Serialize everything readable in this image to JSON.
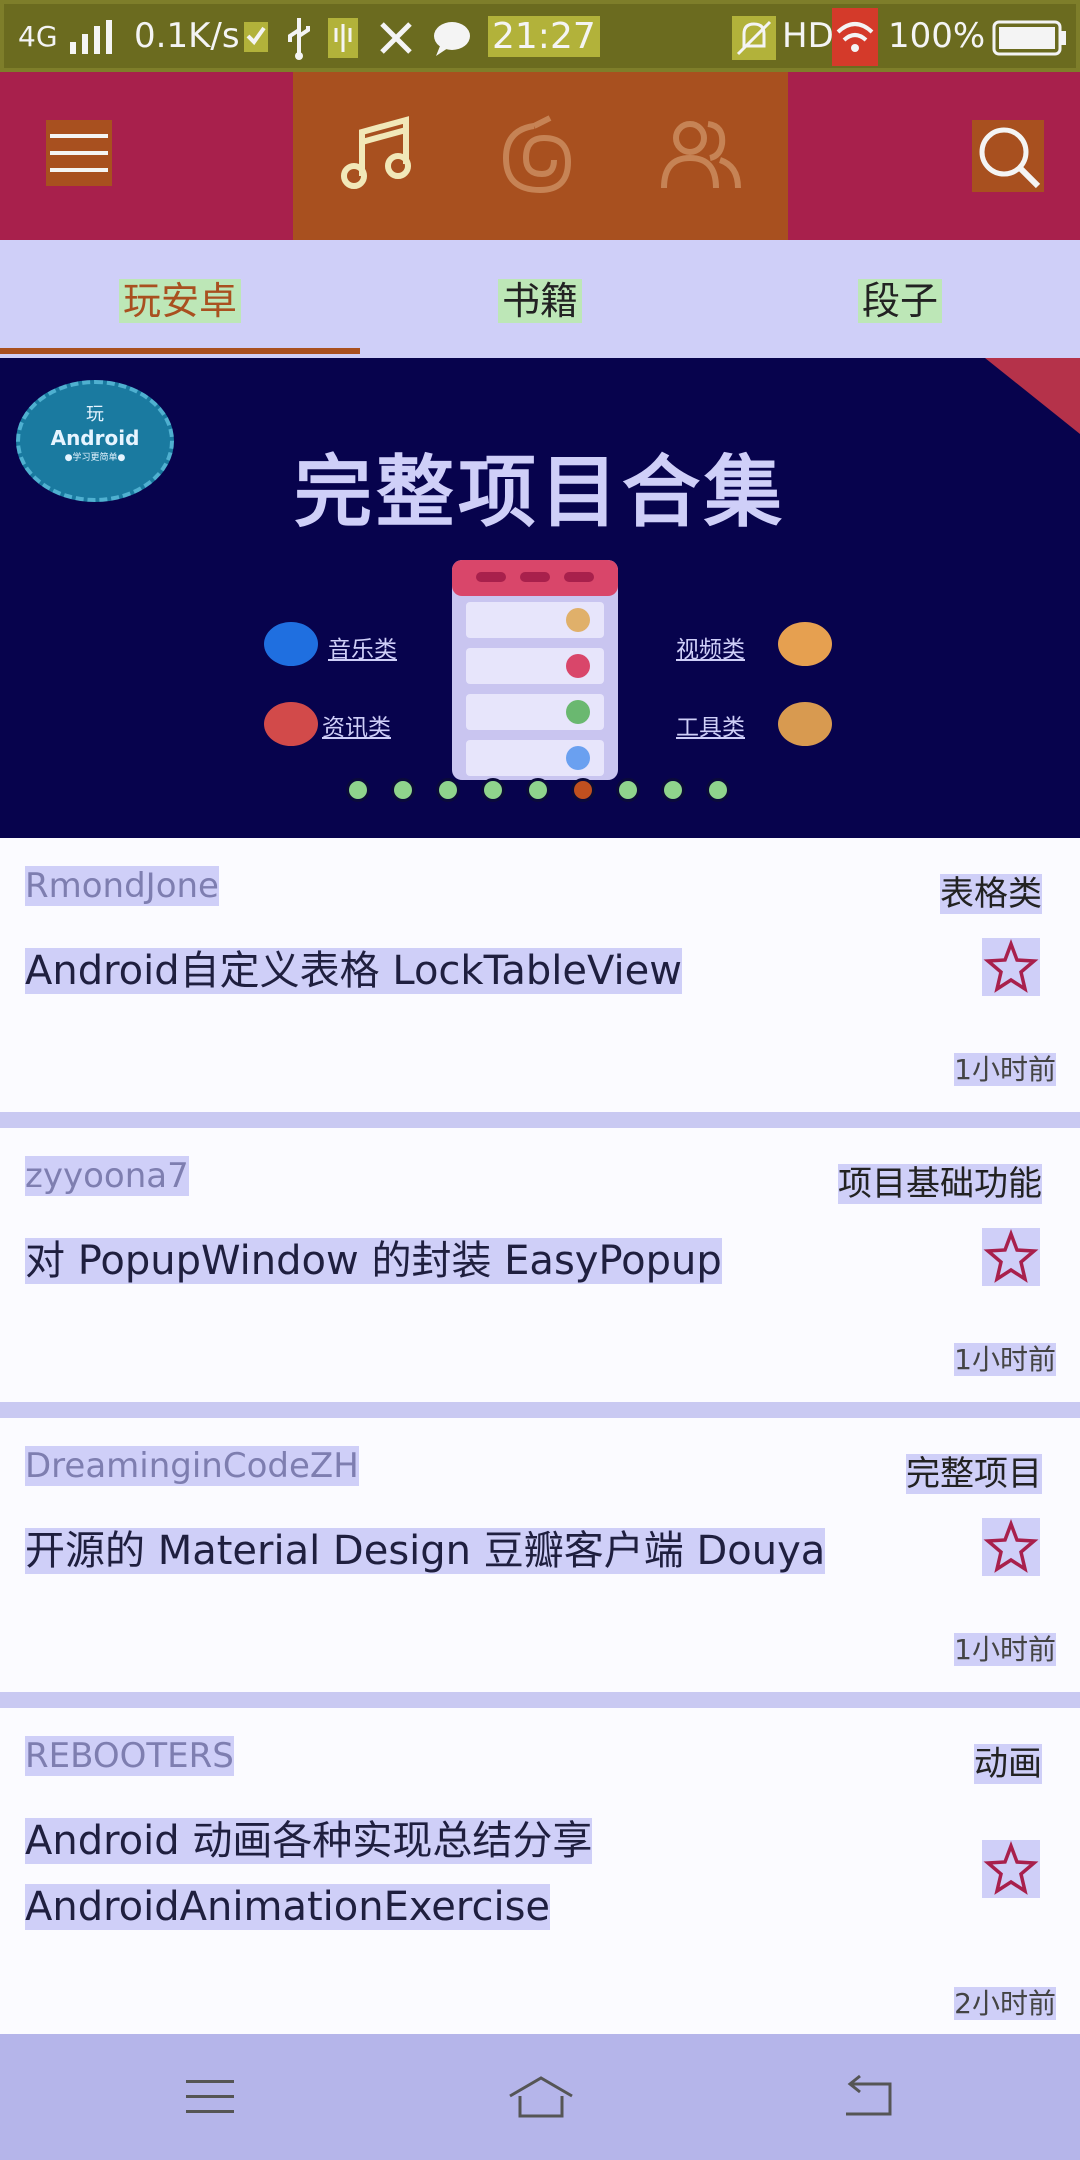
{
  "status_bar": {
    "network": "4G",
    "speed": "0.1K/s",
    "time": "21:27",
    "hd": "HD",
    "battery": "100%"
  },
  "toolbar": {
    "menu_icon": "hamburger-icon",
    "tabs": [
      "music-note-icon",
      "swirl-icon",
      "users-icon"
    ],
    "search_icon": "search-icon"
  },
  "tabs": [
    {
      "label": "玩安卓",
      "active": true
    },
    {
      "label": "书籍",
      "active": false
    },
    {
      "label": "段子",
      "active": false
    }
  ],
  "banner": {
    "title": "完整项目合集",
    "logo_top": "玩",
    "logo_main": "Android",
    "logo_sub": "●学习更简单●",
    "categories": {
      "music": "音乐类",
      "news": "资讯类",
      "video": "视频类",
      "tools": "工具类"
    },
    "dots_total": 9,
    "active_dot": 5
  },
  "articles": [
    {
      "author": "RmondJone",
      "chapter": "表格类",
      "title": "Android自定义表格 LockTableView",
      "time": "1小时前"
    },
    {
      "author": "zyyoona7",
      "chapter": "项目基础功能",
      "title": "对 PopupWindow 的封装 EasyPopup",
      "time": "1小时前"
    },
    {
      "author": "DreaminginCodeZH",
      "chapter": "完整项目",
      "title": "开源的 Material Design 豆瓣客户端 Douya",
      "time": "1小时前"
    },
    {
      "author": "REBOOTERS",
      "chapter": "动画",
      "title_lines": [
        "Android 动画各种实现总结分享",
        "AndroidAnimationExercise"
      ],
      "time": "2小时前"
    }
  ],
  "nav_bar": {
    "menu_icon": "menu-icon",
    "home_icon": "home-icon",
    "back_icon": "back-icon"
  },
  "colors": {
    "toolbar": "#a8204c",
    "toolbar_center": "#a8501f",
    "tabs_bg": "#cfcff8",
    "accent": "#a9501f",
    "banner_bg": "#07034d",
    "star": "#a8204c"
  }
}
